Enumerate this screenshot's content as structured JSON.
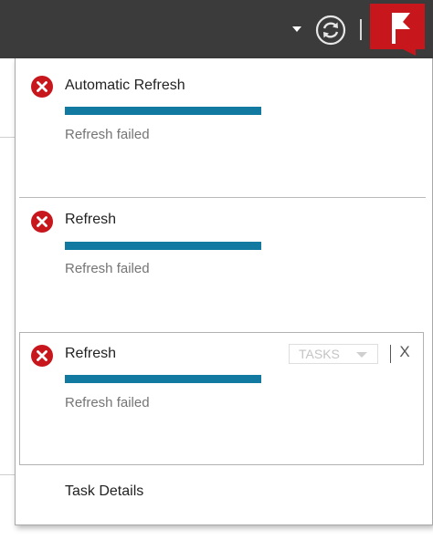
{
  "header": {
    "icons": [
      "chevron-down-icon",
      "refresh-icon",
      "flag-icon"
    ],
    "colors": {
      "bar": "#3b3b3b",
      "flag_bg": "#c8161d"
    }
  },
  "notifications": {
    "colors": {
      "progress": "#127aa0",
      "error": "#c8161d"
    },
    "tasks": [
      {
        "title": "Automatic Refresh",
        "status": "Refresh failed",
        "progress": 1.0
      },
      {
        "title": "Refresh",
        "status": "Refresh failed",
        "progress": 1.0
      },
      {
        "title": "Refresh",
        "status": "Refresh failed",
        "progress": 1.0,
        "tasks_label": "TASKS",
        "close_label": "X"
      }
    ],
    "footer_link": "Task Details"
  }
}
